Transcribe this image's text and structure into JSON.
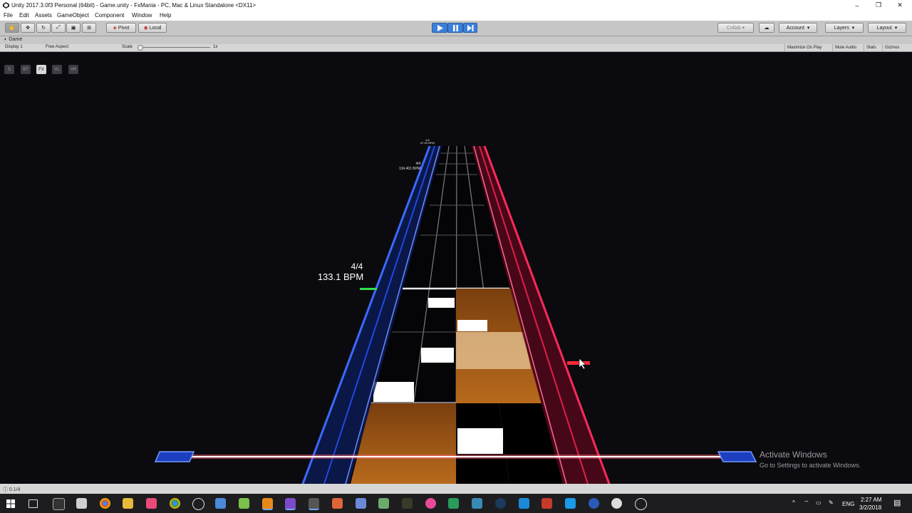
{
  "window": {
    "title": "Unity 2017.3.0f3 Personal (64bit) - Game.unity - FxMania - PC, Mac & Linux Standalone <DX11>",
    "minimize": "–",
    "restore": "❐",
    "close": "✕"
  },
  "menu": [
    "File",
    "Edit",
    "Assets",
    "GameObject",
    "Component",
    "Window",
    "Help"
  ],
  "toolbar": {
    "pivot": "Pivot",
    "local": "Local",
    "collab": "Collab ▾",
    "account": "Account",
    "layers": "Layers",
    "layout": "Layout"
  },
  "tab": {
    "label": "Game"
  },
  "gamebar": {
    "display": "Display 1",
    "aspect": "Free Aspect",
    "scale_label": "Scale",
    "scale_value": "1x",
    "maximize": "Maximize On Play",
    "mute": "Mute Audio",
    "stats": "Stats",
    "gizmos": "Gizmos"
  },
  "modes": [
    "S",
    "BT",
    "FX",
    "VL",
    "VR"
  ],
  "active_mode": "FX",
  "hud": {
    "signature_main": "4/4",
    "bpm_main": "133.1 BPM",
    "signature_far1": "4/4",
    "bpm_far1": "67.00 BPM",
    "signature_far2": "4/4",
    "bpm_far2": "134.401 BPM"
  },
  "watermark": {
    "title": "Activate Windows",
    "sub": "Go to Settings to activate Windows."
  },
  "status": {
    "text": "0.1/4"
  },
  "tray": {
    "lang": "ENG",
    "time": "2:27 AM",
    "date": "3/2/2018",
    "caret": "^"
  },
  "colors": {
    "lane_left": "#2a57ff",
    "lane_right": "#ff2a5a",
    "judgement": "#ff2a3a",
    "hold": "#b5661a",
    "play_blue": "#3b7fd8"
  }
}
